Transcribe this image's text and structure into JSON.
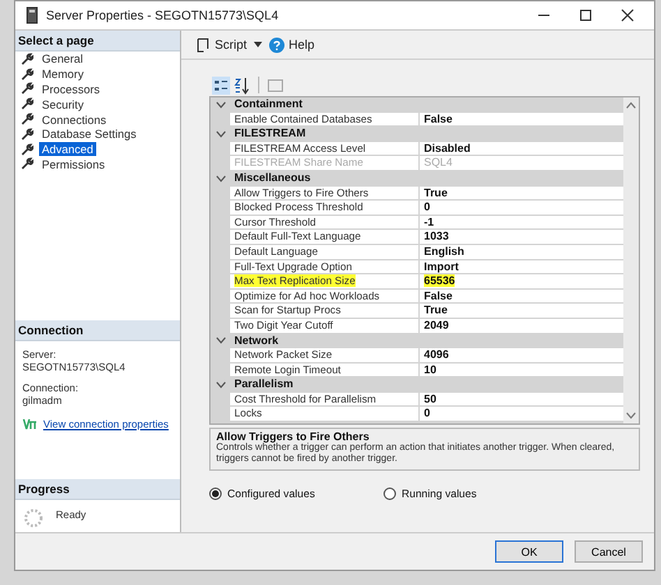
{
  "window": {
    "title": "Server Properties - SEGOTN15773\\SQL4"
  },
  "sidebar": {
    "header": "Select a page",
    "pages": [
      {
        "label": "General",
        "selected": false
      },
      {
        "label": "Memory",
        "selected": false
      },
      {
        "label": "Processors",
        "selected": false
      },
      {
        "label": "Security",
        "selected": false
      },
      {
        "label": "Connections",
        "selected": false
      },
      {
        "label": "Database Settings",
        "selected": false
      },
      {
        "label": "Advanced",
        "selected": true
      },
      {
        "label": "Permissions",
        "selected": false
      }
    ]
  },
  "connection": {
    "header": "Connection",
    "server_label": "Server:",
    "server": "SEGOTN15773\\SQL4",
    "connection_label": "Connection:",
    "connection": "gilmadm",
    "link": "View connection properties"
  },
  "progress": {
    "header": "Progress",
    "status": "Ready"
  },
  "toolbar": {
    "script": "Script",
    "help": "Help"
  },
  "grid": {
    "categories": [
      {
        "name": "Containment",
        "expanded": true,
        "properties": [
          {
            "name": "Enable Contained Databases",
            "value": "False",
            "disabled": false,
            "highlighted": false
          }
        ]
      },
      {
        "name": "FILESTREAM",
        "expanded": true,
        "properties": [
          {
            "name": "FILESTREAM Access Level",
            "value": "Disabled",
            "disabled": false,
            "highlighted": false
          },
          {
            "name": "FILESTREAM Share Name",
            "value": "SQL4",
            "disabled": true,
            "highlighted": false
          }
        ]
      },
      {
        "name": "Miscellaneous",
        "expanded": true,
        "properties": [
          {
            "name": "Allow Triggers to Fire Others",
            "value": "True",
            "disabled": false,
            "highlighted": false
          },
          {
            "name": "Blocked Process Threshold",
            "value": "0",
            "disabled": false,
            "highlighted": false
          },
          {
            "name": "Cursor Threshold",
            "value": "-1",
            "disabled": false,
            "highlighted": false
          },
          {
            "name": "Default Full-Text Language",
            "value": "1033",
            "disabled": false,
            "highlighted": false
          },
          {
            "name": "Default Language",
            "value": "English",
            "disabled": false,
            "highlighted": false
          },
          {
            "name": "Full-Text Upgrade Option",
            "value": "Import",
            "disabled": false,
            "highlighted": false
          },
          {
            "name": "Max Text Replication Size",
            "value": "65536",
            "disabled": false,
            "highlighted": true
          },
          {
            "name": "Optimize for Ad hoc Workloads",
            "value": "False",
            "disabled": false,
            "highlighted": false
          },
          {
            "name": "Scan for Startup Procs",
            "value": "True",
            "disabled": false,
            "highlighted": false
          },
          {
            "name": "Two Digit Year Cutoff",
            "value": "2049",
            "disabled": false,
            "highlighted": false
          }
        ]
      },
      {
        "name": "Network",
        "expanded": true,
        "properties": [
          {
            "name": "Network Packet Size",
            "value": "4096",
            "disabled": false,
            "highlighted": false
          },
          {
            "name": "Remote Login Timeout",
            "value": "10",
            "disabled": false,
            "highlighted": false
          }
        ]
      },
      {
        "name": "Parallelism",
        "expanded": true,
        "properties": [
          {
            "name": "Cost Threshold for Parallelism",
            "value": "50",
            "disabled": false,
            "highlighted": false
          },
          {
            "name": "Locks",
            "value": "0",
            "disabled": false,
            "highlighted": false
          }
        ]
      }
    ]
  },
  "description": {
    "title": "Allow Triggers to Fire Others",
    "text": "Controls whether a trigger can perform an action that initiates another trigger. When cleared, triggers cannot be fired by another trigger."
  },
  "radios": [
    {
      "label": "Configured values",
      "selected": true
    },
    {
      "label": "Running values",
      "selected": false
    }
  ],
  "buttons": [
    {
      "label": "OK",
      "default": true
    },
    {
      "label": "Cancel",
      "default": false
    }
  ]
}
